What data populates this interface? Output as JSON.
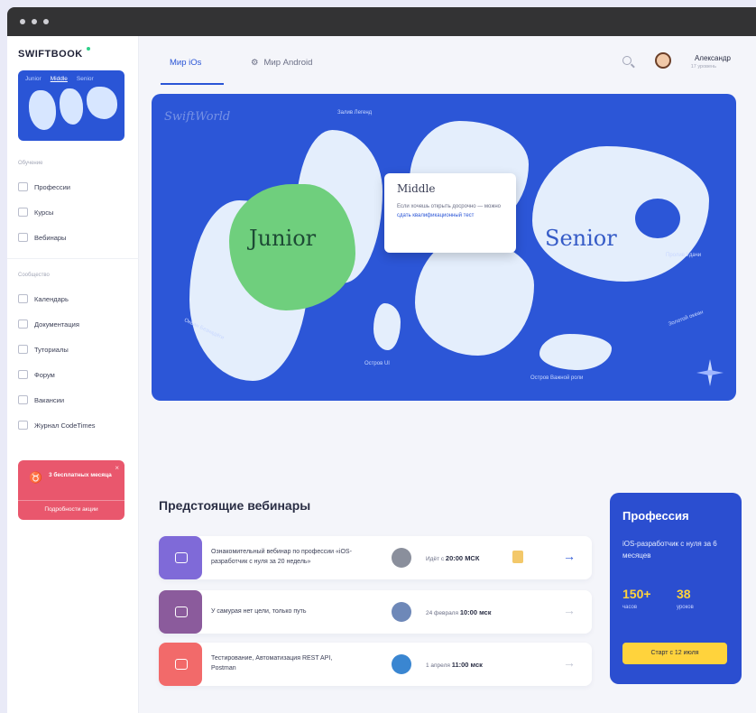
{
  "app": {
    "logo": "SWIFTBOOK"
  },
  "sidebar": {
    "mini_map_tabs": [
      "Junior",
      "Middle",
      "Senior"
    ],
    "section_learning": "Обучение",
    "learning_items": [
      {
        "label": "Профессии",
        "icon": "briefcase-icon"
      },
      {
        "label": "Курсы",
        "icon": "book-icon"
      },
      {
        "label": "Вебинары",
        "icon": "video-icon"
      }
    ],
    "section_community": "Сообщество",
    "community_items": [
      {
        "label": "Календарь",
        "icon": "calendar-icon"
      },
      {
        "label": "Документация",
        "icon": "document-icon"
      },
      {
        "label": "Туториалы",
        "icon": "tutorial-icon"
      },
      {
        "label": "Форум",
        "icon": "forum-icon"
      },
      {
        "label": "Вакансии",
        "icon": "vacancy-icon"
      },
      {
        "label": "Журнал CodeTimes",
        "icon": "journal-icon"
      }
    ],
    "promo": {
      "text": "3 бесплатных месяца",
      "link": "Подробности акции",
      "close": "×"
    }
  },
  "header": {
    "tabs": [
      {
        "label": "Мир iOs",
        "icon": "apple-icon",
        "active": true
      },
      {
        "label": "Мир Android",
        "icon": "android-icon",
        "active": false
      }
    ],
    "user": {
      "name": "Александр",
      "sub": "17 уровень"
    }
  },
  "map": {
    "brand": "SwiftWorld",
    "labels": {
      "junior": "Junior",
      "senior": "Senior"
    },
    "popup": {
      "title": "Middle",
      "text": "Если хочешь открыть досрочно — можно ",
      "link": "сдать квалификационный тест"
    },
    "notes": [
      "Океан Безнадёги",
      "Остров UI",
      "Остров Важной роли",
      "Залив Легенд",
      "Золотой океан",
      "Пролив Удачи"
    ]
  },
  "webinars": {
    "title": "Предстоящие вебинары",
    "items": [
      {
        "name": "Ознакомительный вебинар по профессии «iOS-разработчик с нуля за 20 недель»",
        "date_prefix": "Идёт с ",
        "date_bold": "20:00 МСК",
        "thumb": "#7f6ad8",
        "avatar": "#8a8f9c",
        "active": true
      },
      {
        "name": "У самурая нет цели, только путь",
        "date_prefix": "24 февраля ",
        "date_bold": "10:00 мск",
        "thumb": "#8b5b9c",
        "avatar": "#6e88b8",
        "active": false
      },
      {
        "name": "Тестирование, Автоматизация REST API, Postman",
        "date_prefix": "1 апреля ",
        "date_bold": "11:00 мск",
        "thumb": "#f26a6a",
        "avatar": "#3a86d1",
        "active": false
      }
    ]
  },
  "profession": {
    "title": "Профессия",
    "subtitle": "iOS-разработчик с нуля за 6 месяцев",
    "stats": [
      {
        "value": "150+",
        "unit": "часов"
      },
      {
        "value": "38",
        "unit": "уроков"
      }
    ],
    "button": "Старт с 12 июля"
  },
  "colors": {
    "accent": "#2a55d6",
    "map": "#2c56d7",
    "junior": "#6fcf7d",
    "promo": "#e9576d",
    "cta": "#ffd33c"
  }
}
